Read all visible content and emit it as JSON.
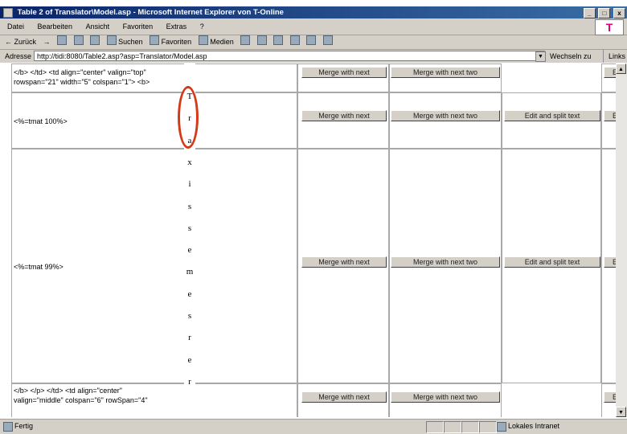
{
  "window": {
    "title": "Table 2 of Translator\\Model.asp - Microsoft Internet Explorer von T-Online",
    "controls": [
      "_",
      "□",
      "x"
    ],
    "brand": "T"
  },
  "menu": [
    "Datei",
    "Bearbeiten",
    "Ansicht",
    "Favoriten",
    "Extras",
    "?"
  ],
  "toolbar": {
    "back": "← Zurück",
    "forward": "→",
    "search": "Suchen",
    "favorites": "Favoriten",
    "media": "Medien"
  },
  "address": {
    "label": "Adresse",
    "url": "http://tidi:8080/Table2.asp?asp=Translator/Model.asp",
    "go": "Wechseln zu",
    "links": "Links"
  },
  "page": {
    "row1_text_lines": [
      "</b> </td> <td align=\"center\" valign=\"top\"",
      "rowspan=\"21\" width=\"5\" colspan=\"1\"> <b>"
    ],
    "row2_text": "<%=tmat 100%>",
    "row3_text": "<%=tmat 99%>",
    "row4_text_lines": [
      "</b> </p> </td> <td align=\"center\"",
      "valign=\"middle\" colspan=\"6\" rowSpan=\"4\""
    ],
    "vertical_chars": [
      "T",
      "r",
      "a",
      "x",
      "i",
      "s",
      "s",
      "e",
      "m",
      "e",
      "s",
      "r",
      "e",
      "r"
    ],
    "btn_merge_next": "Merge with next",
    "btn_merge_next_two": "Merge with next two",
    "btn_edit_split": "Edit and split text",
    "btn_edit_cut": "Edit"
  },
  "status": {
    "left": "Fertig",
    "zone": "Lokales Intranet"
  }
}
